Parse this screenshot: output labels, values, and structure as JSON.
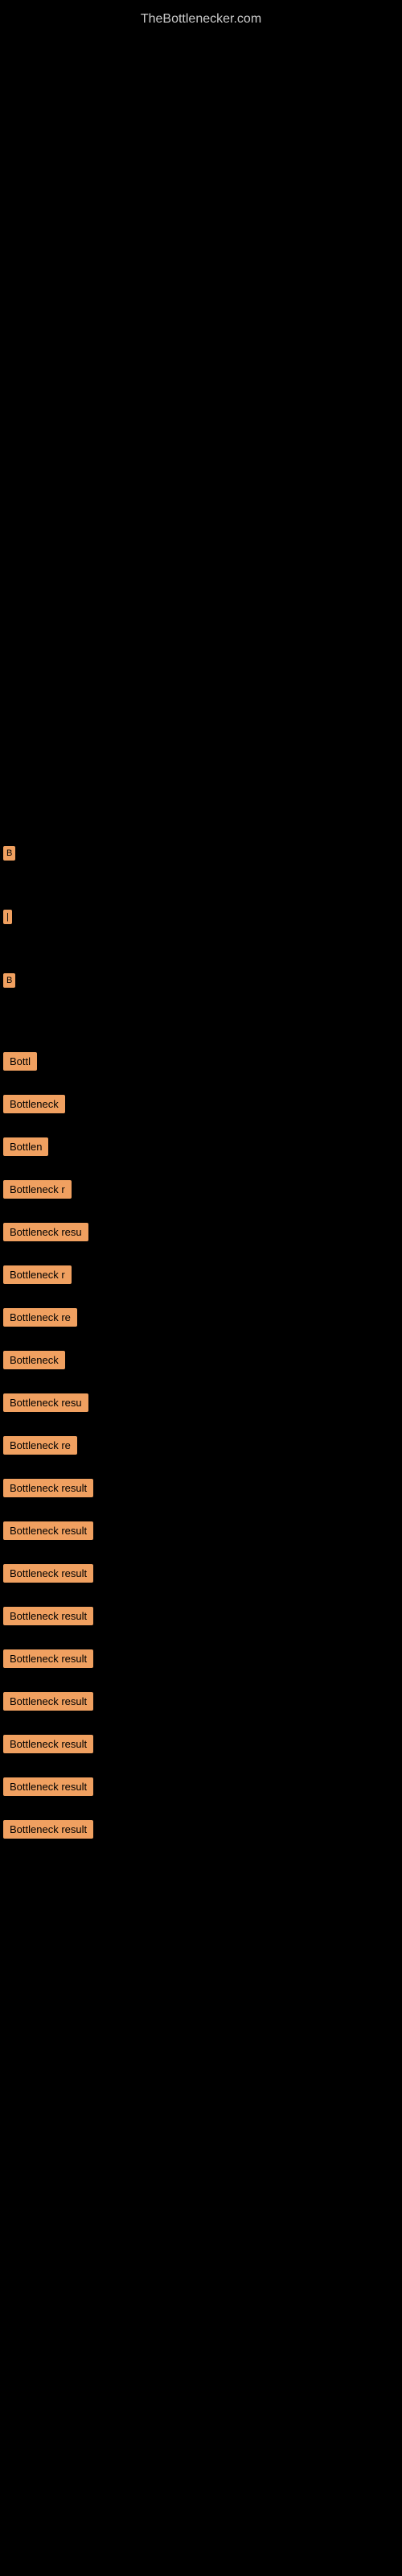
{
  "site": {
    "title": "TheBottlenecker.com"
  },
  "items": [
    {
      "id": 1,
      "label": "B",
      "class": "item-1"
    },
    {
      "id": 2,
      "label": "|",
      "class": "item-2"
    },
    {
      "id": 3,
      "label": "B",
      "class": "item-3"
    },
    {
      "id": 4,
      "label": "Bottl",
      "class": "item-4"
    },
    {
      "id": 5,
      "label": "Bottleneck",
      "class": "item-5"
    },
    {
      "id": 6,
      "label": "Bottlen",
      "class": "item-6"
    },
    {
      "id": 7,
      "label": "Bottleneck r",
      "class": "item-7"
    },
    {
      "id": 8,
      "label": "Bottleneck resu",
      "class": "item-8"
    },
    {
      "id": 9,
      "label": "Bottleneck r",
      "class": "item-9"
    },
    {
      "id": 10,
      "label": "Bottleneck re",
      "class": "item-10"
    },
    {
      "id": 11,
      "label": "Bottleneck",
      "class": "item-11"
    },
    {
      "id": 12,
      "label": "Bottleneck resu",
      "class": "item-12"
    },
    {
      "id": 13,
      "label": "Bottleneck re",
      "class": "item-13"
    },
    {
      "id": 14,
      "label": "Bottleneck result",
      "class": "item-14"
    },
    {
      "id": 15,
      "label": "Bottleneck result",
      "class": "item-15"
    },
    {
      "id": 16,
      "label": "Bottleneck result",
      "class": "item-16"
    },
    {
      "id": 17,
      "label": "Bottleneck result",
      "class": "item-17"
    },
    {
      "id": 18,
      "label": "Bottleneck result",
      "class": "item-18"
    },
    {
      "id": 19,
      "label": "Bottleneck result",
      "class": "item-19"
    },
    {
      "id": 20,
      "label": "Bottleneck result",
      "class": "item-20"
    },
    {
      "id": 21,
      "label": "Bottleneck result",
      "class": "item-21"
    },
    {
      "id": 22,
      "label": "Bottleneck result",
      "class": "item-22"
    }
  ]
}
